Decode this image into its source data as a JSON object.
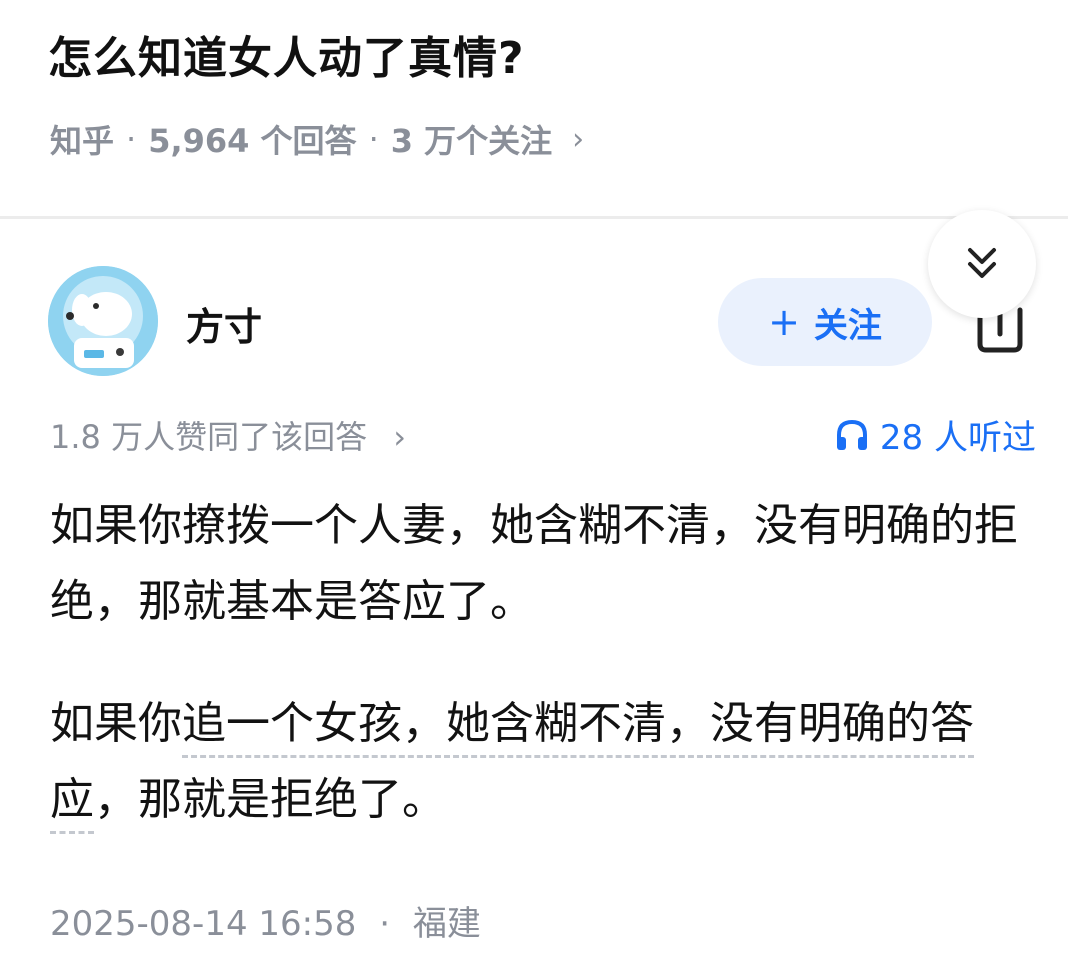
{
  "question": {
    "title": "怎么知道女人动了真情?",
    "source": "知乎",
    "answer_count": "5,964 个回答",
    "follower_count": "3 万个关注",
    "chevron": "›"
  },
  "author": {
    "name": "方寸",
    "avatar_icon": "astronaut-dog-avatar",
    "follow_label": "关注",
    "follow_plus": "+"
  },
  "answer": {
    "vote_text": "1.8 万人赞同了该回答",
    "vote_chevron": "›",
    "listen_text": "28 人听过",
    "paragraphs": [
      "如果你撩拨一个人妻，她含糊不清，没有明确的拒绝，那就基本是答应了。",
      {
        "before": "如果你",
        "underlined": "追一个女孩，她含糊不清，没有明确的答应",
        "after": "，那就是拒绝了。"
      }
    ],
    "time": "2025-08-14 16:58",
    "location": "福建"
  },
  "colors": {
    "accent": "#1a6ff5",
    "muted": "#8a8f99",
    "follow_bg": "#eaf1fd",
    "avatar_bg": "#8fd3f0"
  }
}
